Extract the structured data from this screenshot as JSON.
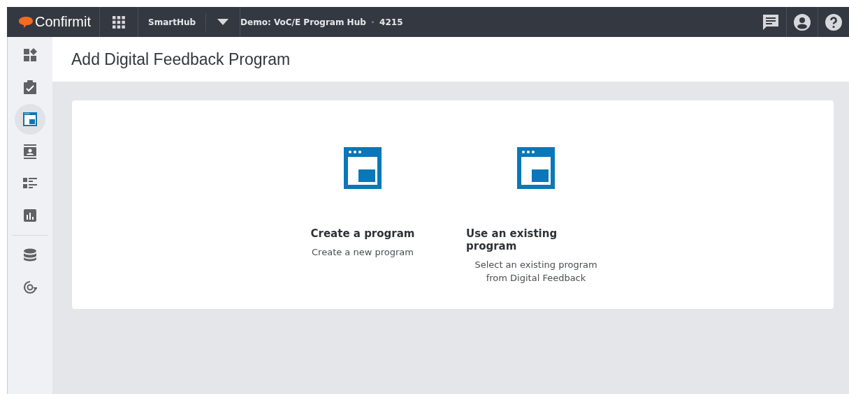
{
  "header": {
    "logo": "Confirmit",
    "app": "SmartHub",
    "project": "Demo: VoC/E Program Hub",
    "separator": "•",
    "project_id": "4215"
  },
  "sidebar": {
    "items": [
      {
        "kind": "dashboard",
        "selected": false
      },
      {
        "kind": "tasks",
        "selected": false
      },
      {
        "kind": "program",
        "selected": true
      },
      {
        "kind": "contacts",
        "selected": false
      },
      {
        "kind": "list",
        "selected": false
      },
      {
        "kind": "chart",
        "selected": false
      },
      {
        "kind": "divider"
      },
      {
        "kind": "database",
        "selected": false
      },
      {
        "kind": "refresh",
        "selected": false
      }
    ]
  },
  "page": {
    "title": "Add Digital Feedback Program"
  },
  "options": [
    {
      "title": "Create a program",
      "description": "Create a new program"
    },
    {
      "title": "Use an existing program",
      "description": "Select an existing program from Digital Feedback"
    }
  ]
}
